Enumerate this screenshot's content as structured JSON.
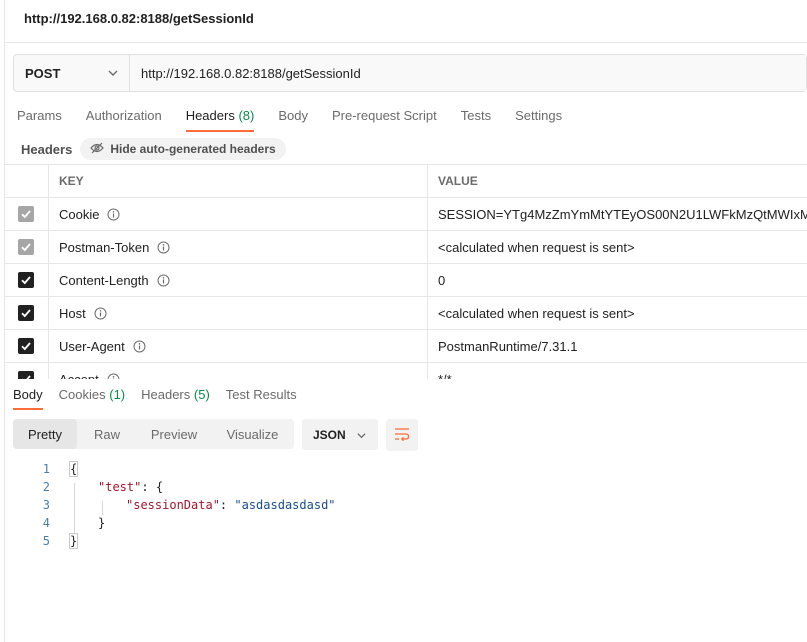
{
  "request": {
    "title": "http://192.168.0.82:8188/getSessionId",
    "method": "POST",
    "url": "http://192.168.0.82:8188/getSessionId"
  },
  "request_tabs": [
    {
      "label": "Params",
      "count": ""
    },
    {
      "label": "Authorization",
      "count": ""
    },
    {
      "label": "Headers",
      "count": "(8)"
    },
    {
      "label": "Body",
      "count": ""
    },
    {
      "label": "Pre-request Script",
      "count": ""
    },
    {
      "label": "Tests",
      "count": ""
    },
    {
      "label": "Settings",
      "count": ""
    }
  ],
  "active_request_tab": "Headers",
  "headers_section": {
    "label": "Headers",
    "hide_button": "Hide auto-generated headers",
    "col_key": "KEY",
    "col_value": "VALUE",
    "rows": [
      {
        "key": "Cookie",
        "value": "SESSION=YTg4MzZmYmMtYTEyOS00N2U1LWFkMzQtMWIxM...",
        "checked": true,
        "disabled": true
      },
      {
        "key": "Postman-Token",
        "value": "<calculated when request is sent>",
        "checked": true,
        "disabled": true
      },
      {
        "key": "Content-Length",
        "value": "0",
        "checked": true,
        "disabled": false
      },
      {
        "key": "Host",
        "value": "<calculated when request is sent>",
        "checked": true,
        "disabled": false
      },
      {
        "key": "User-Agent",
        "value": "PostmanRuntime/7.31.1",
        "checked": true,
        "disabled": false
      },
      {
        "key": "Accept",
        "value": "*/*",
        "checked": true,
        "disabled": false
      }
    ]
  },
  "response_tabs": [
    {
      "label": "Body",
      "count": ""
    },
    {
      "label": "Cookies",
      "count": "(1)"
    },
    {
      "label": "Headers",
      "count": "(5)"
    },
    {
      "label": "Test Results",
      "count": ""
    }
  ],
  "active_response_tab": "Body",
  "view_modes": [
    "Pretty",
    "Raw",
    "Preview",
    "Visualize"
  ],
  "active_view_mode": "Pretty",
  "format": "JSON",
  "code_lines": [
    {
      "n": "1",
      "indent": 0,
      "key": "",
      "sep": "",
      "value": "",
      "text": "{"
    },
    {
      "n": "2",
      "indent": 1,
      "key": "\"test\"",
      "sep": ": ",
      "value": "",
      "text": "{"
    },
    {
      "n": "3",
      "indent": 2,
      "key": "\"sessionData\"",
      "sep": ": ",
      "value": "\"asdasdasdasd\"",
      "text": ""
    },
    {
      "n": "4",
      "indent": 1,
      "key": "",
      "sep": "",
      "value": "",
      "text": "}"
    },
    {
      "n": "5",
      "indent": 0,
      "key": "",
      "sep": "",
      "value": "",
      "text": "}"
    }
  ],
  "colors": {
    "accent": "#ff6c37",
    "count_green": "#0c8b4e",
    "json_key": "#a3152d",
    "json_string": "#174d8c"
  }
}
